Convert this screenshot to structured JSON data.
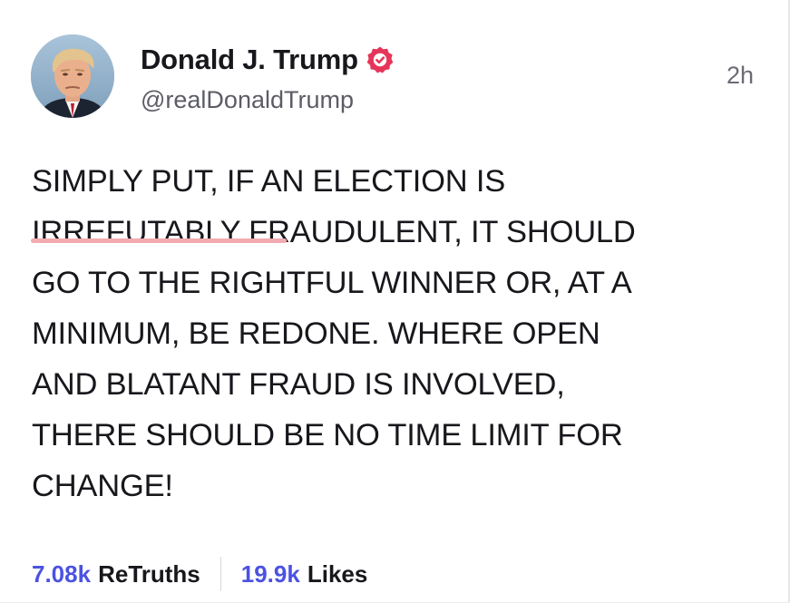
{
  "post": {
    "author": {
      "display_name": "Donald J. Trump",
      "handle": "@realDonaldTrump",
      "verified": true,
      "verified_icon": "verified-badge-icon",
      "verified_color": "#e5365a"
    },
    "timestamp": "2h",
    "body_lines": [
      "SIMPLY PUT, IF AN ELECTION IS",
      "IRREFUTABLY FRAUDULENT, IT SHOULD",
      "GO TO THE RIGHTFUL WINNER OR, AT A",
      "MINIMUM, BE REDONE. WHERE OPEN",
      "AND BLATANT FRAUD IS INVOLVED,",
      "THERE SHOULD BE NO TIME LIMIT FOR",
      "CHANGE!"
    ],
    "spellcheck_flag_word": "IRREFUTABLY",
    "stats": {
      "retruths_count": "7.08k",
      "retruths_label": "ReTruths",
      "likes_count": "19.9k",
      "likes_label": "Likes"
    }
  },
  "colors": {
    "accent": "#4b52e3",
    "text": "#17171c",
    "secondary_text": "#5c5c66",
    "spellcheck_underline": "#f3aab0"
  }
}
